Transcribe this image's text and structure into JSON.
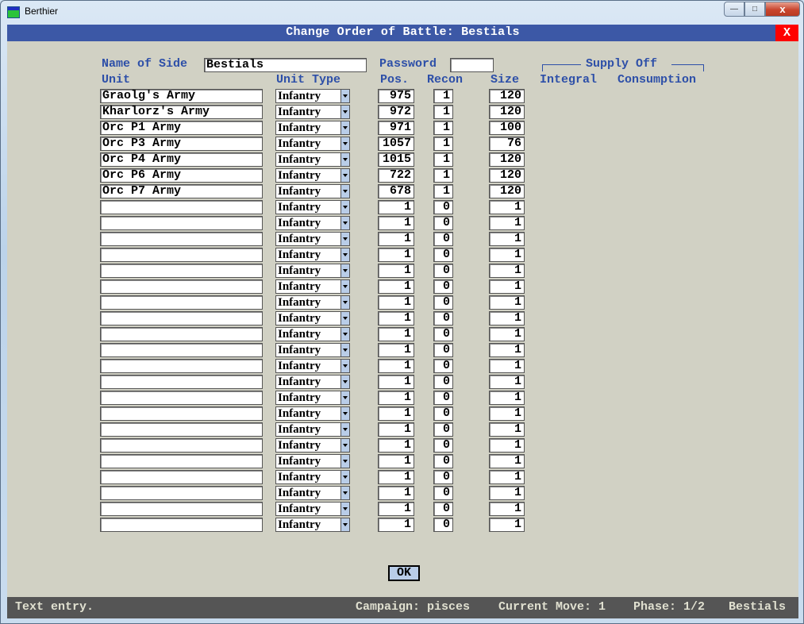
{
  "window": {
    "title": "Berthier",
    "controls": {
      "minimize": "—",
      "maximize": "□",
      "close": "x"
    }
  },
  "dialog": {
    "title": "Change Order of Battle: Bestials",
    "close_label": "X"
  },
  "side": {
    "name_label": "Name of Side",
    "name_value": "Bestials",
    "password_label": "Password",
    "password_value": ""
  },
  "supply": {
    "group_label": "Supply Off",
    "integral_label": "Integral",
    "consumption_label": "Consumption"
  },
  "columns": {
    "unit": "Unit",
    "unit_type": "Unit Type",
    "pos": "Pos.",
    "recon": "Recon",
    "size": "Size"
  },
  "rows": [
    {
      "unit": "Graolg's Army",
      "type": "Infantry",
      "pos": "975",
      "recon": "1",
      "size": "120"
    },
    {
      "unit": "Kharlorz's Army",
      "type": "Infantry",
      "pos": "972",
      "recon": "1",
      "size": "120"
    },
    {
      "unit": "Orc P1 Army",
      "type": "Infantry",
      "pos": "971",
      "recon": "1",
      "size": "100"
    },
    {
      "unit": "Orc P3 Army",
      "type": "Infantry",
      "pos": "1057",
      "recon": "1",
      "size": "76"
    },
    {
      "unit": "Orc P4 Army",
      "type": "Infantry",
      "pos": "1015",
      "recon": "1",
      "size": "120"
    },
    {
      "unit": "Orc P6 Army",
      "type": "Infantry",
      "pos": "722",
      "recon": "1",
      "size": "120"
    },
    {
      "unit": "Orc P7 Army",
      "type": "Infantry",
      "pos": "678",
      "recon": "1",
      "size": "120"
    },
    {
      "unit": "",
      "type": "Infantry",
      "pos": "1",
      "recon": "0",
      "size": "1"
    },
    {
      "unit": "",
      "type": "Infantry",
      "pos": "1",
      "recon": "0",
      "size": "1"
    },
    {
      "unit": "",
      "type": "Infantry",
      "pos": "1",
      "recon": "0",
      "size": "1"
    },
    {
      "unit": "",
      "type": "Infantry",
      "pos": "1",
      "recon": "0",
      "size": "1"
    },
    {
      "unit": "",
      "type": "Infantry",
      "pos": "1",
      "recon": "0",
      "size": "1"
    },
    {
      "unit": "",
      "type": "Infantry",
      "pos": "1",
      "recon": "0",
      "size": "1"
    },
    {
      "unit": "",
      "type": "Infantry",
      "pos": "1",
      "recon": "0",
      "size": "1"
    },
    {
      "unit": "",
      "type": "Infantry",
      "pos": "1",
      "recon": "0",
      "size": "1"
    },
    {
      "unit": "",
      "type": "Infantry",
      "pos": "1",
      "recon": "0",
      "size": "1"
    },
    {
      "unit": "",
      "type": "Infantry",
      "pos": "1",
      "recon": "0",
      "size": "1"
    },
    {
      "unit": "",
      "type": "Infantry",
      "pos": "1",
      "recon": "0",
      "size": "1"
    },
    {
      "unit": "",
      "type": "Infantry",
      "pos": "1",
      "recon": "0",
      "size": "1"
    },
    {
      "unit": "",
      "type": "Infantry",
      "pos": "1",
      "recon": "0",
      "size": "1"
    },
    {
      "unit": "",
      "type": "Infantry",
      "pos": "1",
      "recon": "0",
      "size": "1"
    },
    {
      "unit": "",
      "type": "Infantry",
      "pos": "1",
      "recon": "0",
      "size": "1"
    },
    {
      "unit": "",
      "type": "Infantry",
      "pos": "1",
      "recon": "0",
      "size": "1"
    },
    {
      "unit": "",
      "type": "Infantry",
      "pos": "1",
      "recon": "0",
      "size": "1"
    },
    {
      "unit": "",
      "type": "Infantry",
      "pos": "1",
      "recon": "0",
      "size": "1"
    },
    {
      "unit": "",
      "type": "Infantry",
      "pos": "1",
      "recon": "0",
      "size": "1"
    },
    {
      "unit": "",
      "type": "Infantry",
      "pos": "1",
      "recon": "0",
      "size": "1"
    },
    {
      "unit": "",
      "type": "Infantry",
      "pos": "1",
      "recon": "0",
      "size": "1"
    }
  ],
  "ok_label": "OK",
  "status": {
    "message": "Text entry.",
    "campaign": "Campaign: pisces",
    "move": "Current Move: 1",
    "phase": "Phase: 1/2",
    "side": "Bestials"
  },
  "colors": {
    "dialog_header": "#3c58a6",
    "close_red": "#ff0000",
    "label_blue": "#2d4fa8",
    "background": "#d1d1c4",
    "status_bar": "#555555"
  }
}
